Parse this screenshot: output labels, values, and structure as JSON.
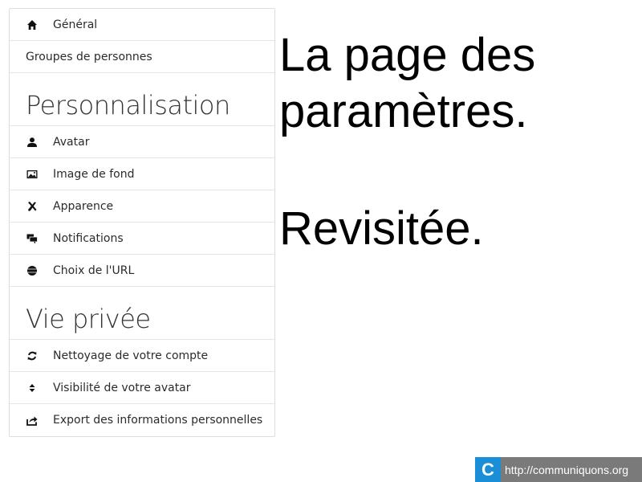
{
  "menu": {
    "top_items": [
      {
        "label": "Général",
        "icon": "home-icon"
      },
      {
        "label": "Groupes de personnes"
      }
    ],
    "sections": [
      {
        "title": "Personnalisation",
        "items": [
          {
            "label": "Avatar",
            "icon": "user-icon"
          },
          {
            "label": "Image de fond",
            "icon": "picture-icon"
          },
          {
            "label": "Apparence",
            "icon": "tools-icon"
          },
          {
            "label": "Notifications",
            "icon": "comments-icon"
          },
          {
            "label": "Choix de l'URL",
            "icon": "globe-icon"
          }
        ]
      },
      {
        "title": "Vie privée",
        "items": [
          {
            "label": "Nettoyage de votre compte",
            "icon": "refresh-icon"
          },
          {
            "label": "Visibilité de votre avatar",
            "icon": "sort-icon"
          },
          {
            "label": "Export des informations personnelles",
            "icon": "share-icon"
          }
        ]
      }
    ]
  },
  "headline": {
    "line1": "La page des",
    "line2": "paramètres.",
    "line3": "Revisitée."
  },
  "footer": {
    "logo_letter": "C",
    "url": "http://communiquons.org",
    "logo_color": "#1a8fd8"
  }
}
